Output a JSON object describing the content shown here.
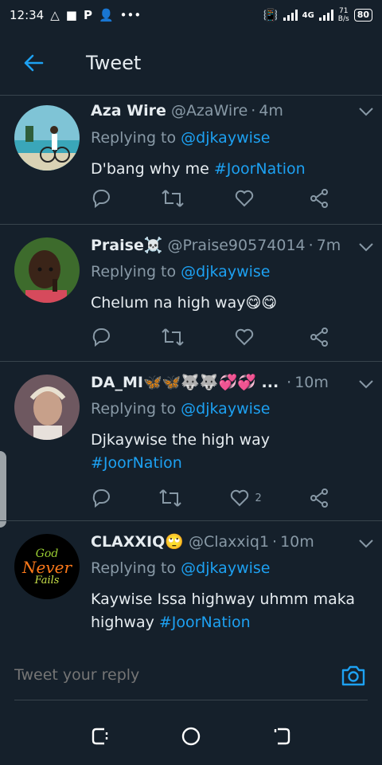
{
  "status_bar": {
    "time": "12:34",
    "net_type": "4G",
    "speed_value": "71",
    "speed_unit": "B/s",
    "battery": "80"
  },
  "header": {
    "title": "Tweet"
  },
  "tweets": [
    {
      "name": "Aza Wire",
      "handle": "@AzaWire",
      "time": "4m",
      "replying_label": "Replying to",
      "replying_to": "@djkaywise",
      "text": "D'bang why me ",
      "hashtag": "#JoorNation",
      "likes": ""
    },
    {
      "name": "Praise☠️",
      "handle": "@Praise90574014",
      "time": "7m",
      "replying_label": "Replying to",
      "replying_to": "@djkaywise",
      "text": "Chelum na high way😋😋",
      "hashtag": "",
      "likes": ""
    },
    {
      "name": "DA_MI🦋🦋🐺🐺💞💞 ...",
      "handle": "",
      "time": "10m",
      "replying_label": "Replying to",
      "replying_to": "@djkaywise",
      "text": "Djkaywise the high way ",
      "hashtag": "#JoorNation",
      "likes": "2"
    },
    {
      "name": "CLAXXIQ🙄",
      "handle": "@Claxxiq1",
      "time": "10m",
      "replying_label": "Replying to",
      "replying_to": "@djkaywise",
      "text": "Kaywise Issa highway uhmm maka highway ",
      "hashtag": "#JoorNation",
      "likes": ""
    }
  ],
  "avatar4": {
    "line1": "God",
    "line2": "Never",
    "line3": "Fails"
  },
  "reply_bar": {
    "placeholder": "Tweet your reply"
  },
  "colors": {
    "background": "#15202b",
    "accent": "#1da1f2",
    "muted": "#8899a6",
    "divider": "#38444d"
  }
}
